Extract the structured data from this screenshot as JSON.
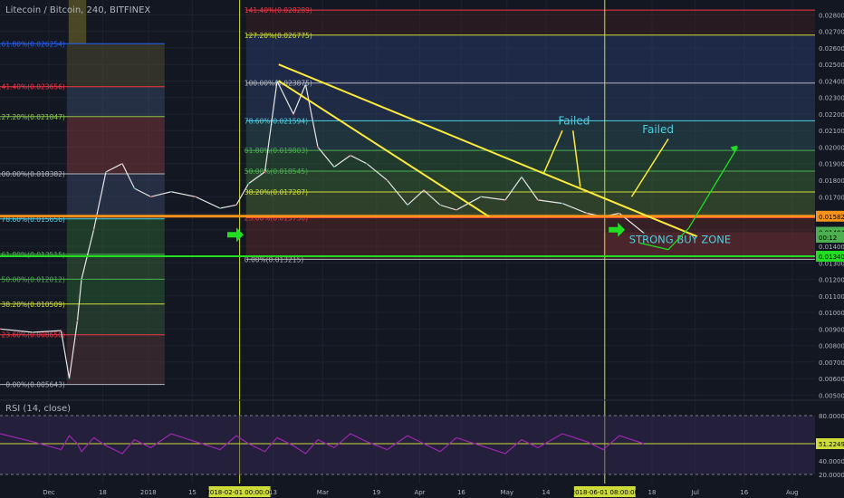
{
  "chart": {
    "title": "Litecoin / Bitcoin, 240, BITFINEX"
  },
  "rsi": {
    "label": "RSI (14, close)",
    "levels": [
      80,
      20
    ],
    "value_label": "51.2249",
    "ticks": [
      "80.0000",
      "40.0000",
      "20.0000"
    ]
  },
  "price_axis": {
    "ticks": [
      "0.028000",
      "0.027000",
      "0.026000",
      "0.025000",
      "0.024000",
      "0.023000",
      "0.022000",
      "0.021000",
      "0.020000",
      "0.019000",
      "0.018000",
      "0.017000",
      "0.016000",
      "0.015000",
      "0.014000",
      "0.013000",
      "0.012000",
      "0.011000",
      "0.010000",
      "0.009000",
      "0.008000",
      "0.007000",
      "0.006000",
      "0.005000"
    ]
  },
  "price_badges": [
    {
      "text": "0.015821",
      "value": 0.015821,
      "color": "#f7931a"
    },
    {
      "text": "0.014849",
      "value": 0.014849,
      "color": "#4caf50"
    },
    {
      "text": "00:12",
      "value": 0.014549,
      "color": "#4caf50"
    },
    {
      "text": "0.013400",
      "value": 0.0134,
      "color": "#22dd22"
    }
  ],
  "time_axis": {
    "labels": [
      {
        "text": "Dec",
        "pos": 0.06
      },
      {
        "text": "18",
        "pos": 0.126
      },
      {
        "text": "2018",
        "pos": 0.182
      },
      {
        "text": "15",
        "pos": 0.236
      },
      {
        "text": "2018-02-01 00:00:00",
        "pos": 0.294,
        "highlight": true
      },
      {
        "text": "13",
        "pos": 0.335
      },
      {
        "text": "Mar",
        "pos": 0.396
      },
      {
        "text": "19",
        "pos": 0.462
      },
      {
        "text": "Apr",
        "pos": 0.515
      },
      {
        "text": "16",
        "pos": 0.566
      },
      {
        "text": "May",
        "pos": 0.622
      },
      {
        "text": "14",
        "pos": 0.67
      },
      {
        "text": "2018-06-01 08:00:00",
        "pos": 0.742,
        "highlight": true
      },
      {
        "text": "18",
        "pos": 0.8
      },
      {
        "text": "Jul",
        "pos": 0.853
      },
      {
        "text": "16",
        "pos": 0.913
      },
      {
        "text": "Aug",
        "pos": 0.972
      }
    ]
  },
  "fib_left": {
    "levels": [
      {
        "label": "161.80%(0.026254)",
        "value": 0.026254,
        "color": "#2962ff"
      },
      {
        "label": "141.40%(0.023656)",
        "value": 0.023656,
        "color": "#f23645"
      },
      {
        "label": "127.20%(0.021847)",
        "value": 0.021847,
        "color": "#8bc34a"
      },
      {
        "label": "100.00%(0.018382)",
        "value": 0.018382,
        "color": "#b2b5be"
      },
      {
        "label": "78.60%(0.015656)",
        "value": 0.015656,
        "color": "#4dd0e1"
      },
      {
        "label": "61.80%(0.013515)",
        "value": 0.013515,
        "color": "#4caf50"
      },
      {
        "label": "50.00%(0.012012)",
        "value": 0.012012,
        "color": "#4caf50"
      },
      {
        "label": "38.20%(0.010509)",
        "value": 0.010509,
        "color": "#cddc39"
      },
      {
        "label": "23.60%(0.008650)",
        "value": 0.00865,
        "color": "#f23645"
      },
      {
        "label": "0.00%(0.005643)",
        "value": 0.005643,
        "color": "#b2b5be"
      }
    ]
  },
  "fib_right": {
    "levels": [
      {
        "label": "141.40%(0.028289)",
        "value": 0.028289,
        "color": "#f23645"
      },
      {
        "label": "127.20%(0.026775)",
        "value": 0.026775,
        "color": "#cddc39"
      },
      {
        "label": "100.00%(0.023875)",
        "value": 0.023875,
        "color": "#b2b5be"
      },
      {
        "label": "78.60%(0.021594)",
        "value": 0.021594,
        "color": "#4dd0e1"
      },
      {
        "label": "61.80%(0.019803)",
        "value": 0.019803,
        "color": "#4caf50"
      },
      {
        "label": "50.00%(0.018545)",
        "value": 0.018545,
        "color": "#4caf50"
      },
      {
        "label": "38.20%(0.017287)",
        "value": 0.017287,
        "color": "#cddc39"
      },
      {
        "label": "23.60%(0.015730)",
        "value": 0.01573,
        "color": "#f23645"
      },
      {
        "label": "0.00%(0.013215)",
        "value": 0.013215,
        "color": "#b2b5be"
      }
    ]
  },
  "annotations": {
    "failed_1": "Failed",
    "failed_2": "Failed",
    "buy_zone": "STRONG BUY ZONE"
  },
  "colors": {
    "background": "#131722",
    "trendline": "#ffeb3b",
    "orange_line": "#f7931a",
    "green_line": "#22dd22",
    "rsi_line": "#9c27b0",
    "arrow_green": "#22dd22",
    "text_failed": "#4dd0e1"
  },
  "chart_data": {
    "type": "line",
    "title": "Litecoin / Bitcoin, 240, BITFINEX",
    "ylim": [
      0.0048,
      0.0289
    ],
    "series": [
      {
        "points": [
          {
            "x": 0.0,
            "y": 0.009
          },
          {
            "x": 0.04,
            "y": 0.0088
          },
          {
            "x": 0.075,
            "y": 0.0089
          },
          {
            "x": 0.085,
            "y": 0.006
          },
          {
            "x": 0.095,
            "y": 0.0095
          },
          {
            "x": 0.1,
            "y": 0.012
          },
          {
            "x": 0.115,
            "y": 0.015
          },
          {
            "x": 0.13,
            "y": 0.0185
          },
          {
            "x": 0.15,
            "y": 0.019
          },
          {
            "x": 0.165,
            "y": 0.0175
          },
          {
            "x": 0.185,
            "y": 0.017
          },
          {
            "x": 0.21,
            "y": 0.0173
          },
          {
            "x": 0.24,
            "y": 0.017
          },
          {
            "x": 0.27,
            "y": 0.0163
          },
          {
            "x": 0.29,
            "y": 0.0165
          },
          {
            "x": 0.305,
            "y": 0.0178
          },
          {
            "x": 0.325,
            "y": 0.0185
          },
          {
            "x": 0.34,
            "y": 0.024
          },
          {
            "x": 0.36,
            "y": 0.022
          },
          {
            "x": 0.375,
            "y": 0.0238
          },
          {
            "x": 0.39,
            "y": 0.02
          },
          {
            "x": 0.41,
            "y": 0.0188
          },
          {
            "x": 0.43,
            "y": 0.0195
          },
          {
            "x": 0.45,
            "y": 0.019
          },
          {
            "x": 0.475,
            "y": 0.018
          },
          {
            "x": 0.5,
            "y": 0.0165
          },
          {
            "x": 0.52,
            "y": 0.0174
          },
          {
            "x": 0.54,
            "y": 0.0165
          },
          {
            "x": 0.56,
            "y": 0.0162
          },
          {
            "x": 0.59,
            "y": 0.017
          },
          {
            "x": 0.62,
            "y": 0.0168
          },
          {
            "x": 0.64,
            "y": 0.0182
          },
          {
            "x": 0.66,
            "y": 0.0168
          },
          {
            "x": 0.69,
            "y": 0.0166
          },
          {
            "x": 0.72,
            "y": 0.016
          },
          {
            "x": 0.74,
            "y": 0.0158
          },
          {
            "x": 0.76,
            "y": 0.016
          },
          {
            "x": 0.79,
            "y": 0.0148
          }
        ]
      }
    ]
  }
}
